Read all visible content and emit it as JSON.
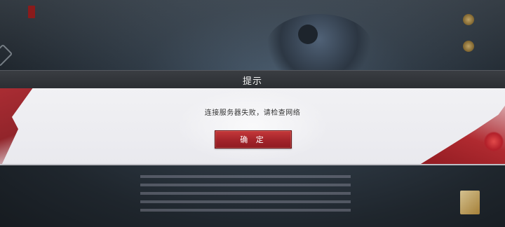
{
  "background": {
    "logo_text": "",
    "colors": {
      "bg_dark": "#1f262d",
      "accent_red": "#a3242a",
      "header_bg": "#2b2e33",
      "body_bg": "#ececf0"
    }
  },
  "dialog": {
    "title": "提示",
    "message": "连接服务器失败，请检查网络",
    "confirm_label": "确 定"
  },
  "icons": {
    "left_button": "diamond-frame-icon",
    "right_top_1": "gold-emblem-icon",
    "right_top_2": "gold-emblem-icon",
    "corner": "gold-book-icon"
  }
}
